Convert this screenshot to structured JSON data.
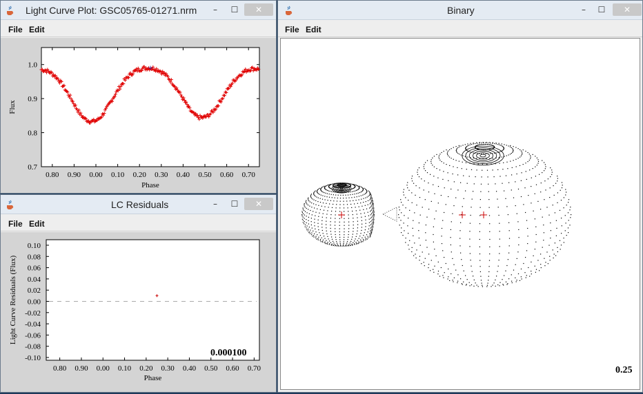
{
  "windows": {
    "lightcurve": {
      "title": "Light Curve Plot: GSC05765-01271.nrm",
      "menu": [
        "File",
        "Edit"
      ],
      "controls": {
        "minimize": "–",
        "maximize": "☐",
        "close": "✕"
      }
    },
    "residuals": {
      "title": "LC Residuals",
      "menu": [
        "File",
        "Edit"
      ],
      "controls": {
        "minimize": "–",
        "maximize": "☐",
        "close": "✕"
      },
      "rms_value": "0.000100"
    },
    "binary": {
      "title": "Binary",
      "menu": [
        "File",
        "Edit"
      ],
      "controls": {
        "minimize": "–",
        "maximize": "☐",
        "close": "✕"
      },
      "phase_value": "0.25"
    }
  },
  "chart_data": [
    {
      "type": "scatter",
      "xlabel": "Phase",
      "ylabel": "Flux",
      "x_tick_labels": [
        "0.80",
        "0.90",
        "0.00",
        "0.10",
        "0.20",
        "0.30",
        "0.40",
        "0.50",
        "0.60",
        "0.70"
      ],
      "y_tick_labels": [
        "1.0",
        "0.9",
        "0.8",
        "0.7"
      ],
      "ylim": [
        0.7,
        1.05
      ],
      "xlim": [
        -0.25,
        0.75
      ],
      "marker_color": "#e00000",
      "current_point_color": "#5a2d8c",
      "series": [
        {
          "x": [
            -0.25,
            -0.23,
            -0.21,
            -0.19,
            -0.17,
            -0.15,
            -0.13,
            -0.11,
            -0.09,
            -0.07,
            -0.05,
            -0.03,
            -0.01,
            0.01,
            0.03,
            0.05,
            0.07,
            0.09,
            0.11,
            0.13,
            0.15,
            0.17,
            0.19,
            0.21,
            0.23,
            0.25,
            0.27,
            0.29,
            0.31,
            0.33,
            0.35,
            0.37,
            0.39,
            0.41,
            0.43,
            0.45,
            0.47,
            0.49,
            0.51,
            0.53,
            0.55,
            0.57,
            0.59,
            0.61,
            0.63,
            0.65,
            0.67,
            0.69,
            0.71,
            0.73,
            0.75
          ],
          "values": [
            0.985,
            0.983,
            0.977,
            0.968,
            0.955,
            0.937,
            0.917,
            0.896,
            0.873,
            0.853,
            0.84,
            0.834,
            0.833,
            0.838,
            0.852,
            0.871,
            0.893,
            0.914,
            0.934,
            0.952,
            0.966,
            0.977,
            0.984,
            0.988,
            0.99,
            0.99,
            0.988,
            0.983,
            0.975,
            0.963,
            0.948,
            0.93,
            0.91,
            0.889,
            0.868,
            0.853,
            0.845,
            0.844,
            0.848,
            0.858,
            0.873,
            0.892,
            0.912,
            0.932,
            0.95,
            0.964,
            0.975,
            0.983,
            0.987,
            0.988,
            0.986
          ]
        }
      ]
    },
    {
      "type": "scatter",
      "xlabel": "Phase",
      "ylabel": "Light Curve Residuals (Flux)",
      "x_tick_labels": [
        "0.80",
        "0.90",
        "0.00",
        "0.10",
        "0.20",
        "0.30",
        "0.40",
        "0.50",
        "0.60",
        "0.70"
      ],
      "y_tick_labels": [
        "0.10",
        "0.08",
        "0.06",
        "0.04",
        "0.02",
        "0.00",
        "-0.02",
        "-0.04",
        "-0.06",
        "-0.08",
        "-0.10"
      ],
      "ylim": [
        -0.1,
        0.1
      ],
      "marker_color": "#cc0000",
      "series": [
        {
          "x": [
            0.25
          ],
          "values": [
            0.0101
          ]
        }
      ]
    }
  ],
  "binary_view": {
    "primary_marker": "+",
    "dot_color": "#000000",
    "marker_color": "#cc0000"
  }
}
